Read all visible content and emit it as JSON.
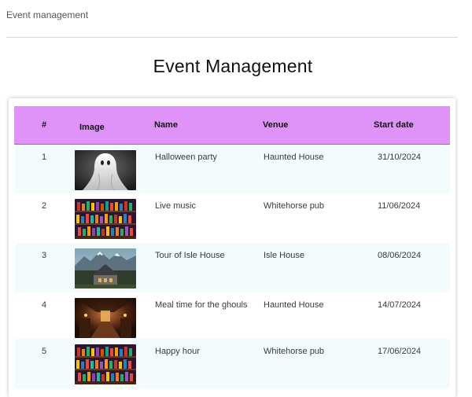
{
  "breadcrumb": "Event management",
  "page_title": "Event Management",
  "table": {
    "headers": {
      "num": "#",
      "image": "Image",
      "name": "Name",
      "venue": "Venue",
      "start_date": "Start date"
    },
    "rows": [
      {
        "num": "1",
        "image": "ghost-image",
        "name": "Halloween party",
        "venue": "Haunted House",
        "start_date": "31/10/2024"
      },
      {
        "num": "2",
        "image": "pub-bar-image",
        "name": "Live music",
        "venue": "Whitehorse pub",
        "start_date": "11/06/2024"
      },
      {
        "num": "3",
        "image": "mountain-house-image",
        "name": "Tour of Isle House",
        "venue": "Isle House",
        "start_date": "08/06/2024"
      },
      {
        "num": "4",
        "image": "dining-hall-image",
        "name": "Meal time for the ghouls",
        "venue": "Haunted House",
        "start_date": "14/07/2024"
      },
      {
        "num": "5",
        "image": "pub-bar-image",
        "name": "Happy hour",
        "venue": "Whitehorse pub",
        "start_date": "17/06/2024"
      }
    ]
  },
  "colors": {
    "header_bg": "#df93f9",
    "striped_row_bg": "#f4fbfc"
  }
}
